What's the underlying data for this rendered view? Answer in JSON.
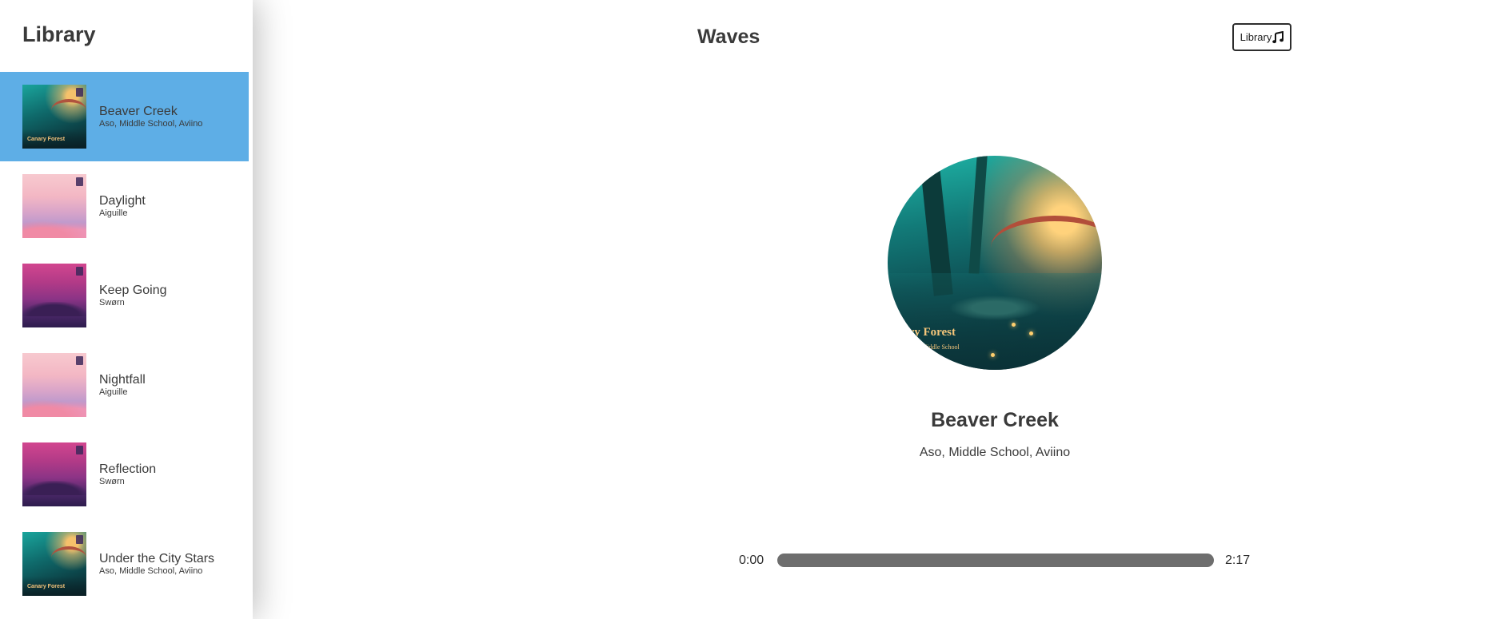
{
  "sidebar": {
    "title": "Library",
    "tracks": [
      {
        "name": "Beaver Creek",
        "artist": "Aso, Middle School, Aviino",
        "cover": "forest-icon",
        "selected": true
      },
      {
        "name": "Daylight",
        "artist": "Aiguille",
        "cover": "pink-sky-icon",
        "selected": false
      },
      {
        "name": "Keep Going",
        "artist": "Swørn",
        "cover": "magenta-sky-icon",
        "selected": false
      },
      {
        "name": "Nightfall",
        "artist": "Aiguille",
        "cover": "pink-sky-icon",
        "selected": false
      },
      {
        "name": "Reflection",
        "artist": "Swørn",
        "cover": "magenta-sky-icon",
        "selected": false
      },
      {
        "name": "Under the City Stars",
        "artist": "Aso, Middle School, Aviino",
        "cover": "forest-icon",
        "selected": false
      }
    ],
    "selected_color": "#5eaee6"
  },
  "header": {
    "title": "Waves",
    "library_button_label": "Library",
    "library_button_icon": "music-note-icon"
  },
  "player": {
    "song_title": "Beaver Creek",
    "song_artist": "Aso, Middle School, Aviino",
    "art_caption": "nary Forest",
    "art_subcaption": "Aso x Middle School",
    "current_time": "0:00",
    "total_time": "2:17",
    "progress": 0
  }
}
